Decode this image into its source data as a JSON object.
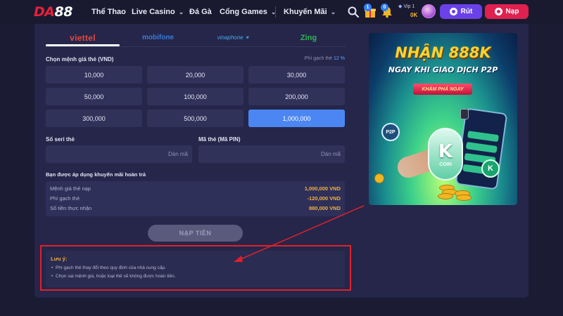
{
  "header": {
    "logo": {
      "part1": "DA",
      "part2": "88"
    },
    "nav": [
      {
        "label": "Thể Thao",
        "dropdown": false
      },
      {
        "label": "Live Casino",
        "dropdown": true
      },
      {
        "label": "Đá Gà",
        "dropdown": false
      },
      {
        "label": "Cổng Games",
        "dropdown": true
      },
      {
        "label": "Khuyến Mãi",
        "dropdown": true
      }
    ],
    "icon_badges": {
      "gift": "1",
      "bell": "0"
    },
    "vip_level": "Vip 1",
    "balance": "0K",
    "withdraw_label": "Rút",
    "deposit_label": "Nạp"
  },
  "carrier_tabs": [
    {
      "label": "viettel",
      "active": true
    },
    {
      "label": "mobifone",
      "active": false
    },
    {
      "label": "vinaphone",
      "active": false
    },
    {
      "label": "Zing",
      "active": false
    }
  ],
  "form": {
    "denomination_label": "Chọn mệnh giá thẻ (VND)",
    "fee_label": "Phí gạch thẻ",
    "fee_value": "12 %",
    "denominations": [
      "10,000",
      "20,000",
      "30,000",
      "50,000",
      "100,000",
      "200,000",
      "300,000",
      "500,000",
      "1,000,000"
    ],
    "selected_denomination": "1,000,000",
    "serial_label": "Số seri thẻ",
    "serial_placeholder": "Dán mã",
    "pin_label": "Mã thẻ (Mã PIN)",
    "pin_placeholder": "Dán mã",
    "promo_note": "Bạn được áp dụng khuyến mãi hoàn trả",
    "summary": [
      {
        "key": "Mệnh giá thẻ nạp",
        "value": "1,000,000 VND"
      },
      {
        "key": "Phí gạch thẻ",
        "value": "-120,000 VND"
      },
      {
        "key": "Số tiền thực nhận",
        "value": "880,000 VND"
      }
    ],
    "submit_label": "NẠP TIỀN"
  },
  "notes": {
    "title": "Lưu ý:",
    "items": [
      "Phí gạch thẻ thay đổi theo quy định của nhà cung cấp.",
      "Chọn sai mệnh giá, hoặc loại thẻ sẽ không được hoàn tiền."
    ]
  },
  "banner": {
    "headline": "NHẬN 888K",
    "subheadline": "NGAY KHI GIAO DỊCH P2P",
    "cta": "KHÁM PHÁ NGAY",
    "p2p_badge": "P2P",
    "coin_letter": "K",
    "coin_label": "COIN",
    "small_badge": "K"
  },
  "colors": {
    "accent_blue": "#4b86f3",
    "deposit_red": "#e0204f",
    "withdraw_purple": "#6a41e8",
    "amount_gold": "#f4b13b",
    "annotation_red": "#e0202a"
  }
}
